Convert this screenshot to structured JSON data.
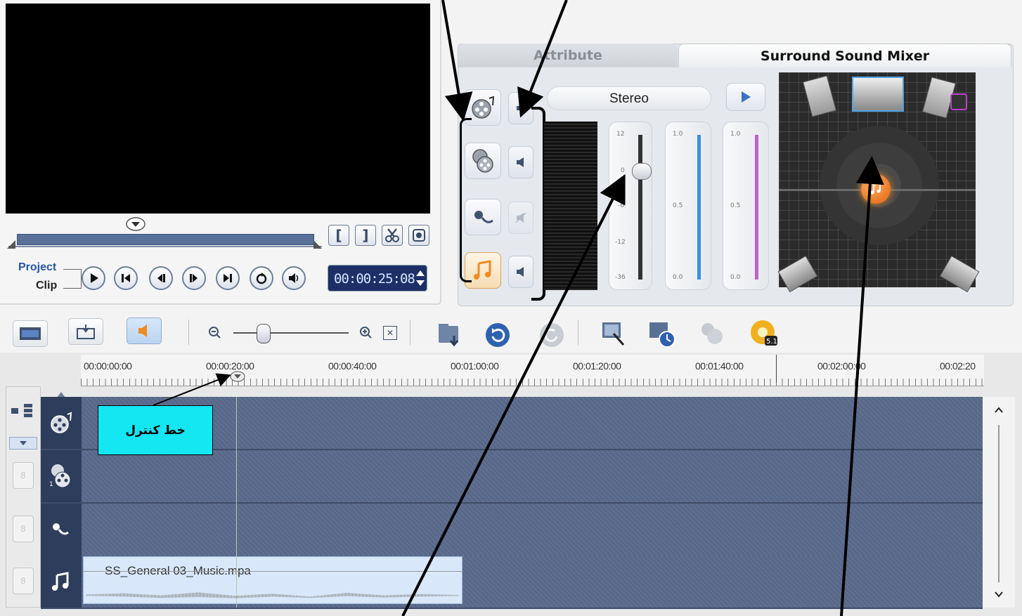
{
  "preview": {
    "project_label": "Project",
    "clip_label": "Clip",
    "timecode": "00:00:25:08",
    "mark_in": "[",
    "mark_out": "]"
  },
  "tabs": [
    {
      "label": "Attribute",
      "active": false
    },
    {
      "label": "Surround Sound Mixer",
      "active": true
    }
  ],
  "mixer": {
    "mode": "Stereo",
    "fader_ticks": [
      "12",
      "0",
      "-6",
      "-12",
      "-36"
    ],
    "meter_left_ticks": [
      "1.0",
      "0.5",
      "0.0"
    ],
    "meter_right_ticks": [
      "1.0",
      "0.5",
      "0.0"
    ],
    "icons": {
      "track1": "video-reel-icon",
      "track2": "overlay-reel-icon",
      "track3": "voice-mic-icon",
      "track4": "music-note-icon"
    }
  },
  "timeline": {
    "ruler": [
      "00:00:00:00",
      "00:00:20:00",
      "00:00:40:00",
      "00:01:00:00",
      "00:01:20:00",
      "00:01:40:00",
      "00:02:00:00",
      "00:02:20"
    ],
    "music_clip": "SS_General 03_Music.mpa",
    "annotation": "خط كنترل"
  },
  "colors": {
    "timecode_bg": "#1d2f66",
    "track_bg": "#576789",
    "clip_bg": "#d8e8fa",
    "annotation_bg": "#14e6f2",
    "meter_left": "#3b8ee0",
    "meter_right": "#c060d0",
    "music_accent": "#f08a20"
  }
}
